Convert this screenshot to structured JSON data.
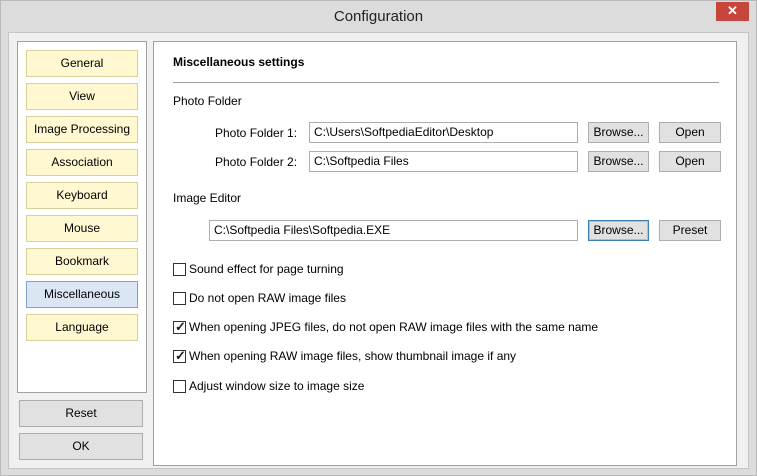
{
  "window": {
    "title": "Configuration",
    "close_glyph": "✕"
  },
  "nav": {
    "items": [
      {
        "label": "General"
      },
      {
        "label": "View"
      },
      {
        "label": "Image Processing"
      },
      {
        "label": "Association"
      },
      {
        "label": "Keyboard"
      },
      {
        "label": "Mouse"
      },
      {
        "label": "Bookmark"
      },
      {
        "label": "Miscellaneous",
        "selected": true
      },
      {
        "label": "Language"
      }
    ]
  },
  "actions": {
    "reset_label": "Reset",
    "ok_label": "OK"
  },
  "misc": {
    "heading": "Miscellaneous settings",
    "photo_folder": {
      "group_label": "Photo Folder",
      "folder1_label": "Photo Folder 1:",
      "folder1_value": "C:\\Users\\SoftpediaEditor\\Desktop",
      "folder2_label": "Photo Folder 2:",
      "folder2_value": "C:\\Softpedia Files",
      "browse_label": "Browse...",
      "open_label": "Open"
    },
    "image_editor": {
      "group_label": "Image Editor",
      "value": "C:\\Softpedia Files\\Softpedia.EXE",
      "browse_label": "Browse...",
      "preset_label": "Preset"
    },
    "options": [
      {
        "label": "Sound effect for page turning",
        "checked": false
      },
      {
        "label": "Do not open RAW image files",
        "checked": false
      },
      {
        "label": "When opening JPEG files, do not open RAW image files with the same name",
        "checked": true
      },
      {
        "label": "When opening RAW image files, show thumbnail image if any",
        "checked": true
      },
      {
        "label": "Adjust window size to image size",
        "checked": false
      }
    ],
    "check_glyph": "✓"
  }
}
